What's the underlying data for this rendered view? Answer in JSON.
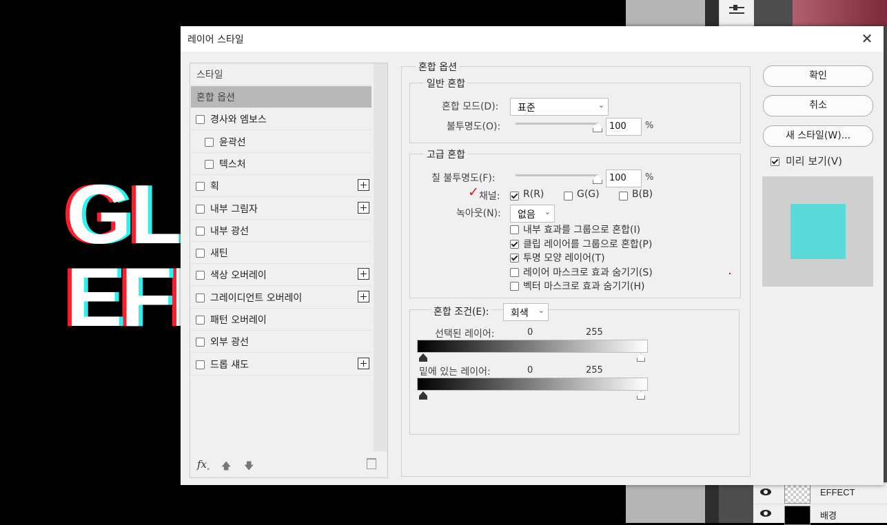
{
  "canvas": {
    "glitch_line1": "GL",
    "glitch_line2": "EFI",
    "colors": {
      "red": "#ff1e2e",
      "cyan": "#2ff0f0",
      "white": "#ffffff"
    }
  },
  "layers_panel": {
    "layers": [
      {
        "name": "EFFECT",
        "visible": true
      },
      {
        "name": "배경",
        "visible": true
      }
    ]
  },
  "dialog": {
    "title": "레이어 스타일",
    "close_icon": "close-icon"
  },
  "style_list": {
    "header_label": "스타일",
    "items": [
      {
        "label": "혼합 옵션",
        "active": true,
        "checkbox": false,
        "plus": false,
        "indent": false
      },
      {
        "label": "경사와 엠보스",
        "checkbox": true,
        "checked": false,
        "plus": false,
        "indent": false
      },
      {
        "label": "윤곽선",
        "checkbox": true,
        "checked": false,
        "plus": false,
        "indent": true
      },
      {
        "label": "텍스처",
        "checkbox": true,
        "checked": false,
        "plus": false,
        "indent": true
      },
      {
        "label": "획",
        "checkbox": true,
        "checked": false,
        "plus": true,
        "indent": false
      },
      {
        "label": "내부 그림자",
        "checkbox": true,
        "checked": false,
        "plus": true,
        "indent": false
      },
      {
        "label": "내부 광선",
        "checkbox": true,
        "checked": false,
        "plus": false,
        "indent": false
      },
      {
        "label": "새틴",
        "checkbox": true,
        "checked": false,
        "plus": false,
        "indent": false
      },
      {
        "label": "색상 오버레이",
        "checkbox": true,
        "checked": false,
        "plus": true,
        "indent": false
      },
      {
        "label": "그레이디언트 오버레이",
        "checkbox": true,
        "checked": false,
        "plus": true,
        "indent": false
      },
      {
        "label": "패턴 오버레이",
        "checkbox": true,
        "checked": false,
        "plus": false,
        "indent": false
      },
      {
        "label": "외부 광선",
        "checkbox": true,
        "checked": false,
        "plus": false,
        "indent": false
      },
      {
        "label": "드롭 섀도",
        "checkbox": true,
        "checked": false,
        "plus": true,
        "indent": false
      }
    ],
    "footer": {
      "fx_label": "fx",
      "fx_arrow": "ˬ"
    }
  },
  "blend": {
    "group_title": "혼합 옵션",
    "general": {
      "title": "일반 혼합",
      "mode_label": "혼합 모드(D):",
      "mode_value": "표준",
      "opacity_label": "불투명도(O):",
      "opacity_value": "100",
      "opacity_unit": "%",
      "opacity_fraction": 1.0
    },
    "advanced": {
      "title": "고급 혼합",
      "fill_label": "칠 불투명도(F):",
      "fill_value": "100",
      "fill_unit": "%",
      "fill_fraction": 1.0,
      "channels_label": "채널:",
      "channels": [
        {
          "label": "R(R)",
          "checked": true
        },
        {
          "label": "G(G)",
          "checked": false
        },
        {
          "label": "B(B)",
          "checked": false
        }
      ],
      "knockout_label": "녹아웃(N):",
      "knockout_value": "없음",
      "options": [
        {
          "label": "내부 효과를 그룹으로 혼합(I)",
          "checked": false
        },
        {
          "label": "클립 레이어를 그룹으로 혼합(P)",
          "checked": true
        },
        {
          "label": "투명 모양 레이어(T)",
          "checked": true
        },
        {
          "label": "레이어 마스크로 효과 숨기기(S)",
          "checked": false
        },
        {
          "label": "벡터 마스크로 효과 숨기기(H)",
          "checked": false
        }
      ]
    },
    "blend_if": {
      "label": "혼합 조건(E):",
      "value": "회색",
      "this_layer_label": "선택된 레이어:",
      "underlying_label": "밑에 있는 레이어:",
      "min": "0",
      "max": "255"
    }
  },
  "buttons": {
    "ok": "확인",
    "cancel": "취소",
    "new_style": "새 스타일(W)...",
    "preview_label": "미리 보기(V)",
    "preview_checked": true,
    "preview_color": "#5bd8d8"
  }
}
